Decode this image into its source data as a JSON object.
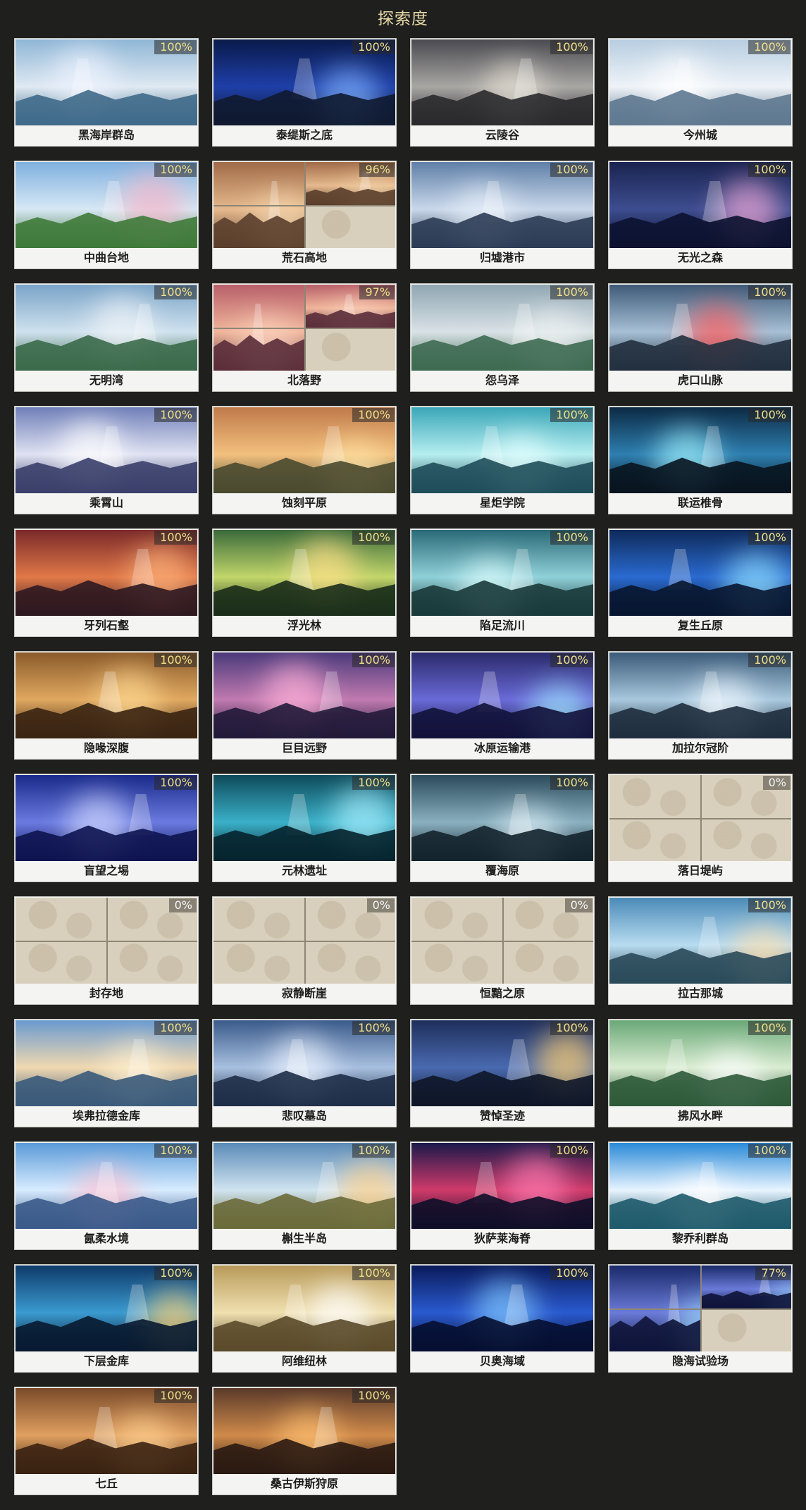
{
  "title": "探索度",
  "colors": {
    "background": "#1f1f1e",
    "title": "#e7d9a8",
    "percent_complete": "#f0e08a",
    "card_bg": "#f4f4f2",
    "locked_fill": "#d8cfbd"
  },
  "regions": [
    {
      "name": "黑海岸群岛",
      "progress": "100%",
      "state": "full",
      "palette": [
        "#8fb6d6",
        "#dfe9f2",
        "#3f6a8a",
        "#eef3ff"
      ]
    },
    {
      "name": "泰缇斯之底",
      "progress": "100%",
      "state": "full",
      "palette": [
        "#0a1a4a",
        "#1e3fa8",
        "#101a30",
        "#7fb2ff"
      ]
    },
    {
      "name": "云陵谷",
      "progress": "100%",
      "state": "full",
      "palette": [
        "#4a4a50",
        "#a9a7a4",
        "#2a2a2e",
        "#e6e0d4"
      ]
    },
    {
      "name": "今州城",
      "progress": "100%",
      "state": "full",
      "palette": [
        "#b7cde0",
        "#eef3f8",
        "#5e7990",
        "#ffffff"
      ]
    },
    {
      "name": "中曲台地",
      "progress": "100%",
      "state": "full",
      "palette": [
        "#7fb0de",
        "#d7e8f5",
        "#3f7a3a",
        "#f4b6c9"
      ]
    },
    {
      "name": "荒石高地",
      "progress": "96%",
      "state": "partial",
      "palette": [
        "#a06b48",
        "#e6b98d",
        "#5b3f2c",
        "#f5d7ae"
      ]
    },
    {
      "name": "归墟港市",
      "progress": "100%",
      "state": "full",
      "palette": [
        "#5f7fa8",
        "#c9d8ea",
        "#2c3c55",
        "#e8f0fa"
      ]
    },
    {
      "name": "无光之森",
      "progress": "100%",
      "state": "full",
      "palette": [
        "#1a2350",
        "#3d4d8f",
        "#0c1230",
        "#f0a8d8"
      ]
    },
    {
      "name": "无明湾",
      "progress": "100%",
      "state": "full",
      "palette": [
        "#7aa4c8",
        "#cfe1ee",
        "#3b6a4a",
        "#f0f4f8"
      ]
    },
    {
      "name": "北落野",
      "progress": "97%",
      "state": "partial",
      "palette": [
        "#b8606a",
        "#f0b59a",
        "#5a2e3a",
        "#ffd7c4"
      ]
    },
    {
      "name": "怨乌泽",
      "progress": "100%",
      "state": "full",
      "palette": [
        "#8fa6b2",
        "#d9e2e6",
        "#3e6a52",
        "#eef2f2"
      ]
    },
    {
      "name": "虎口山脉",
      "progress": "100%",
      "state": "full",
      "palette": [
        "#3e5a78",
        "#a7c0d6",
        "#22303f",
        "#ff5a5a"
      ]
    },
    {
      "name": "乘霄山",
      "progress": "100%",
      "state": "full",
      "palette": [
        "#6f7fb8",
        "#dfe2f2",
        "#3a3f6a",
        "#ffffff"
      ]
    },
    {
      "name": "蚀刻平原",
      "progress": "100%",
      "state": "full",
      "palette": [
        "#c07a4a",
        "#f2c07e",
        "#4a4a30",
        "#ffe6a8"
      ]
    },
    {
      "name": "星炬学院",
      "progress": "100%",
      "state": "full",
      "palette": [
        "#3aa6b8",
        "#b6eef0",
        "#1f4e5a",
        "#e6ffff"
      ]
    },
    {
      "name": "联运椎骨",
      "progress": "100%",
      "state": "full",
      "palette": [
        "#0c2a44",
        "#2e7fb0",
        "#08141f",
        "#9ff2ff"
      ]
    },
    {
      "name": "牙列石壑",
      "progress": "100%",
      "state": "full",
      "palette": [
        "#7a2a2a",
        "#e07848",
        "#2e1820",
        "#ffb27a"
      ]
    },
    {
      "name": "浮光林",
      "progress": "100%",
      "state": "full",
      "palette": [
        "#3a6a3a",
        "#c2d66a",
        "#1a2e1a",
        "#ffe08a"
      ]
    },
    {
      "name": "陷足流川",
      "progress": "100%",
      "state": "full",
      "palette": [
        "#2a6a78",
        "#8fd0d8",
        "#1a3a3a",
        "#e0ffff"
      ]
    },
    {
      "name": "复生丘原",
      "progress": "100%",
      "state": "full",
      "palette": [
        "#0e2a5a",
        "#2a6ad0",
        "#081630",
        "#8fe0ff"
      ]
    },
    {
      "name": "隐喙深腹",
      "progress": "100%",
      "state": "full",
      "palette": [
        "#8a5a2a",
        "#e0a860",
        "#3a2412",
        "#ffd890"
      ]
    },
    {
      "name": "巨目远野",
      "progress": "100%",
      "state": "full",
      "palette": [
        "#4a3a7a",
        "#c07ab0",
        "#221a3a",
        "#ffb0d8"
      ]
    },
    {
      "name": "冰原运输港",
      "progress": "100%",
      "state": "full",
      "palette": [
        "#2a2a6a",
        "#6a6ad8",
        "#12123a",
        "#9fe8ff"
      ]
    },
    {
      "name": "加拉尔冠阶",
      "progress": "100%",
      "state": "full",
      "palette": [
        "#3a5a78",
        "#a8c8de",
        "#1e2e3e",
        "#f0f8ff"
      ]
    },
    {
      "name": "盲望之埸",
      "progress": "100%",
      "state": "full",
      "palette": [
        "#1a2a8a",
        "#6a7ae0",
        "#0e1450",
        "#d0d8ff"
      ]
    },
    {
      "name": "元林遗址",
      "progress": "100%",
      "state": "full",
      "palette": [
        "#0e4a5a",
        "#3ab0c8",
        "#06242e",
        "#a8f0ff"
      ]
    },
    {
      "name": "覆海原",
      "progress": "100%",
      "state": "full",
      "palette": [
        "#2a4a5a",
        "#8ab0c0",
        "#14242e",
        "#dff0f8"
      ]
    },
    {
      "name": "落日堤屿",
      "progress": "0%",
      "state": "locked",
      "palette": []
    },
    {
      "name": "封存地",
      "progress": "0%",
      "state": "locked",
      "palette": []
    },
    {
      "name": "寂静断崖",
      "progress": "0%",
      "state": "locked",
      "palette": []
    },
    {
      "name": "恒黯之原",
      "progress": "0%",
      "state": "locked",
      "palette": []
    },
    {
      "name": "拉古那城",
      "progress": "100%",
      "state": "full",
      "palette": [
        "#4a8ab8",
        "#b8dcf0",
        "#2a4a5a",
        "#ffe0b0"
      ]
    },
    {
      "name": "埃弗拉德金库",
      "progress": "100%",
      "state": "full",
      "palette": [
        "#6a9ad0",
        "#f0d8b0",
        "#3a5a7a",
        "#fff0d0"
      ]
    },
    {
      "name": "悲叹墓岛",
      "progress": "100%",
      "state": "full",
      "palette": [
        "#3a5a8a",
        "#a8c0e0",
        "#1e2e48",
        "#eef4ff"
      ]
    },
    {
      "name": "赞悼圣迹",
      "progress": "100%",
      "state": "full",
      "palette": [
        "#1e2e5a",
        "#4a6ab0",
        "#0e1628",
        "#ffd070"
      ]
    },
    {
      "name": "拂风水畔",
      "progress": "100%",
      "state": "full",
      "palette": [
        "#6aa878",
        "#d8ecd0",
        "#2e5a3a",
        "#ffffff"
      ]
    },
    {
      "name": "氤柔水境",
      "progress": "100%",
      "state": "full",
      "palette": [
        "#5a9ad8",
        "#d8ecff",
        "#3a5a8a",
        "#ffc0d0"
      ]
    },
    {
      "name": "槲生半岛",
      "progress": "100%",
      "state": "full",
      "palette": [
        "#5a8ab8",
        "#d0e4f0",
        "#6a6a3a",
        "#ffd08a"
      ]
    },
    {
      "name": "狄萨莱海脊",
      "progress": "100%",
      "state": "full",
      "palette": [
        "#1a1a4a",
        "#d03a6a",
        "#0e0e28",
        "#ff7ab0"
      ]
    },
    {
      "name": "黎乔利群岛",
      "progress": "100%",
      "state": "full",
      "palette": [
        "#2a8ad8",
        "#e8f4ff",
        "#1e5a6a",
        "#ffffff"
      ]
    },
    {
      "name": "下层金库",
      "progress": "100%",
      "state": "full",
      "palette": [
        "#0e3a6a",
        "#3a9ad0",
        "#081a30",
        "#ffd070"
      ]
    },
    {
      "name": "阿维纽林",
      "progress": "100%",
      "state": "full",
      "palette": [
        "#b89a5a",
        "#f0e0b0",
        "#5a4a2a",
        "#ffffff"
      ]
    },
    {
      "name": "贝奥海域",
      "progress": "100%",
      "state": "full",
      "palette": [
        "#0a1a5a",
        "#2a5ad0",
        "#060e30",
        "#80c8ff"
      ]
    },
    {
      "name": "隐海试验场",
      "progress": "77%",
      "state": "partial",
      "palette": [
        "#1a2a6a",
        "#6a7ad8",
        "#0e1438",
        "#a0e0ff"
      ]
    },
    {
      "name": "七丘",
      "progress": "100%",
      "state": "full",
      "palette": [
        "#7a4a2a",
        "#e0a060",
        "#3a2212",
        "#ffd090"
      ]
    },
    {
      "name": "桑古伊斯狩原",
      "progress": "100%",
      "state": "full",
      "palette": [
        "#5a3a2a",
        "#d08a4a",
        "#2a1a12",
        "#ffc070"
      ]
    }
  ]
}
